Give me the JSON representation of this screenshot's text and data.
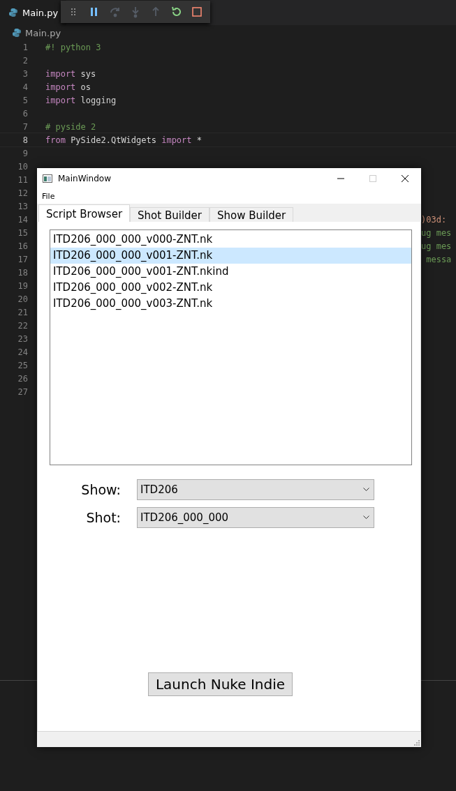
{
  "editor": {
    "tab": {
      "label": "Main.py",
      "selected": true
    },
    "debug_toolbar": [
      {
        "kind": "grip",
        "disabled": false
      },
      {
        "kind": "pause",
        "disabled": false
      },
      {
        "kind": "step-over",
        "disabled": true
      },
      {
        "kind": "step-into",
        "disabled": true
      },
      {
        "kind": "step-out",
        "disabled": true
      },
      {
        "kind": "restart",
        "disabled": false
      },
      {
        "kind": "stop",
        "disabled": false
      }
    ],
    "breadcrumb": "Main.py",
    "lines": [
      {
        "number": "1",
        "current": false,
        "tokens": [
          {
            "kind": "comment",
            "text": "#! python 3"
          }
        ]
      },
      {
        "number": "2",
        "current": false
      },
      {
        "number": "3",
        "current": false,
        "tokens": [
          {
            "kind": "keyword",
            "text": "import"
          },
          {
            "kind": "plain",
            "text": " sys"
          }
        ]
      },
      {
        "number": "4",
        "current": false,
        "tokens": [
          {
            "kind": "keyword",
            "text": "import"
          },
          {
            "kind": "plain",
            "text": " os"
          }
        ]
      },
      {
        "number": "5",
        "current": false,
        "tokens": [
          {
            "kind": "keyword",
            "text": "import"
          },
          {
            "kind": "plain",
            "text": " logging"
          }
        ]
      },
      {
        "number": "6",
        "current": false
      },
      {
        "number": "7",
        "current": false,
        "tokens": [
          {
            "kind": "comment",
            "text": "# pyside 2"
          }
        ]
      },
      {
        "number": "8",
        "current": true,
        "tokens": [
          {
            "kind": "keyword",
            "text": "from"
          },
          {
            "kind": "plain",
            "text": " PySide2.QtWidgets "
          },
          {
            "kind": "keyword",
            "text": "import"
          },
          {
            "kind": "plain",
            "text": " *"
          }
        ]
      },
      {
        "number": "9",
        "current": false
      },
      {
        "number": "10",
        "current": false
      },
      {
        "number": "11",
        "current": false
      },
      {
        "number": "12",
        "current": false
      },
      {
        "number": "13",
        "current": false
      },
      {
        "number": "14",
        "current": false,
        "fragment": true,
        "tokens": [
          {
            "kind": "string",
            "text": ")03d: "
          }
        ]
      },
      {
        "number": "15",
        "current": false,
        "fragment": true,
        "tokens": [
          {
            "kind": "comment",
            "text": "ug mes"
          }
        ]
      },
      {
        "number": "16",
        "current": false,
        "fragment": true,
        "tokens": [
          {
            "kind": "comment",
            "text": "ug mes"
          }
        ]
      },
      {
        "number": "17",
        "current": false,
        "fragment": true,
        "tokens": [
          {
            "kind": "comment",
            "text": " messa"
          }
        ]
      },
      {
        "number": "18",
        "current": false
      },
      {
        "number": "19",
        "current": false
      },
      {
        "number": "20",
        "current": false
      },
      {
        "number": "21",
        "current": false
      },
      {
        "number": "22",
        "current": false
      },
      {
        "number": "23",
        "current": false
      },
      {
        "number": "24",
        "current": false
      },
      {
        "number": "25",
        "current": false
      },
      {
        "number": "26",
        "current": false
      },
      {
        "number": "27",
        "current": false
      }
    ]
  },
  "window": {
    "title": "MainWindow",
    "menu": [
      "File"
    ],
    "tabs": [
      {
        "label": "Script Browser",
        "selected": true
      },
      {
        "label": "Shot Builder",
        "selected": false
      },
      {
        "label": "Show Builder",
        "selected": false
      }
    ],
    "scripts": [
      {
        "label": "ITD206_000_000_v000-ZNT.nk",
        "selected": false
      },
      {
        "label": "ITD206_000_000_v001-ZNT.nk",
        "selected": true
      },
      {
        "label": "ITD206_000_000_v001-ZNT.nkind",
        "selected": false
      },
      {
        "label": "ITD206_000_000_v002-ZNT.nk",
        "selected": false
      },
      {
        "label": "ITD206_000_000_v003-ZNT.nk",
        "selected": false
      }
    ],
    "fields": [
      {
        "label": "Show:",
        "value": "ITD206"
      },
      {
        "label": "Shot:",
        "value": "ITD206_000_000"
      }
    ],
    "button": "Launch Nuke Indie"
  }
}
